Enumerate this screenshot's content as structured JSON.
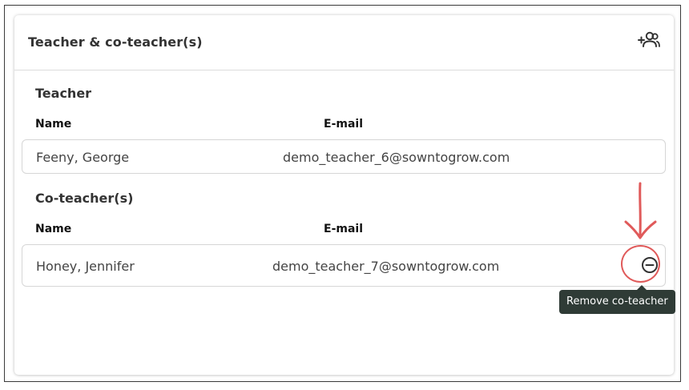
{
  "card": {
    "title": "Teacher & co-teacher(s)",
    "add_icon": "add-person-icon"
  },
  "teacher_section": {
    "title": "Teacher",
    "name_header": "Name",
    "email_header": "E-mail",
    "rows": [
      {
        "name": "Feeny, George",
        "email": "demo_teacher_6@sowntogrow.com"
      }
    ]
  },
  "coteacher_section": {
    "title": "Co-teacher(s)",
    "name_header": "Name",
    "email_header": "E-mail",
    "rows": [
      {
        "name": "Honey, Jennifer",
        "email": "demo_teacher_7@sowntogrow.com",
        "action_icon": "remove-circle-icon"
      }
    ]
  },
  "tooltip": {
    "text": "Remove co-teacher"
  },
  "annotation": {
    "color": "#e05a5a",
    "arrow_icon": "red-arrow-down-icon"
  }
}
